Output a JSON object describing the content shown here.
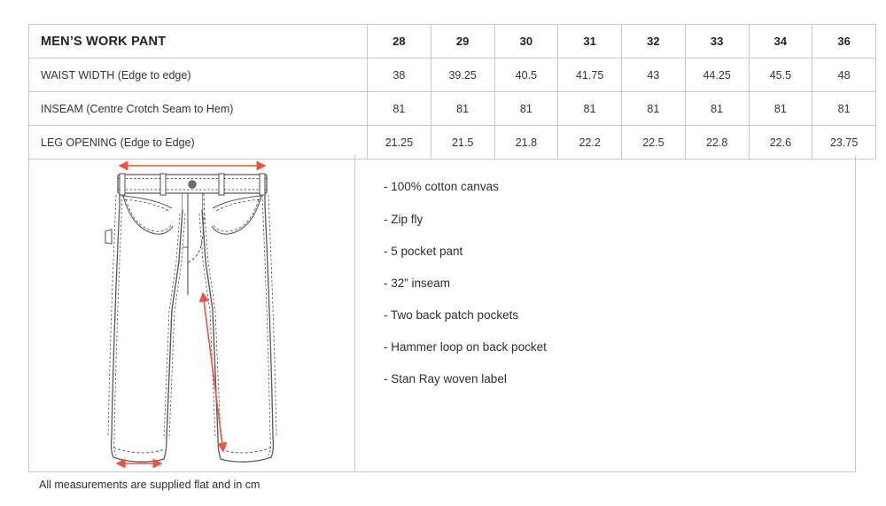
{
  "table": {
    "title": "MEN’S WORK PANT",
    "sizes": [
      "28",
      "29",
      "30",
      "31",
      "32",
      "33",
      "34",
      "36"
    ],
    "rows": [
      {
        "label": "WAIST WIDTH (Edge to edge)",
        "values": [
          "38",
          "39.25",
          "40.5",
          "41.75",
          "43",
          "44.25",
          "45.5",
          "48"
        ]
      },
      {
        "label": "INSEAM (Centre Crotch Seam to Hem)",
        "values": [
          "81",
          "81",
          "81",
          "81",
          "81",
          "81",
          "81",
          "81"
        ]
      },
      {
        "label": "LEG OPENING (Edge to Edge)",
        "values": [
          "21.25",
          "21.5",
          "21.8",
          "22.2",
          "22.5",
          "22.8",
          "22.6",
          "23.75"
        ]
      }
    ]
  },
  "illustration": {
    "name": "work-pant-technical-drawing",
    "measurement_arrows": [
      "waist-width-arrow",
      "inseam-arrow",
      "leg-opening-arrow"
    ],
    "arrow_color": "#f4513c",
    "line_color": "#58595b"
  },
  "specs": [
    "- 100% cotton canvas",
    "- Zip fly",
    "- 5 pocket pant",
    "- 32” inseam",
    "- Two back patch pockets",
    "- Hammer loop on back pocket",
    "- Stan Ray woven label"
  ],
  "footnote": "All measurements are supplied flat and in cm"
}
